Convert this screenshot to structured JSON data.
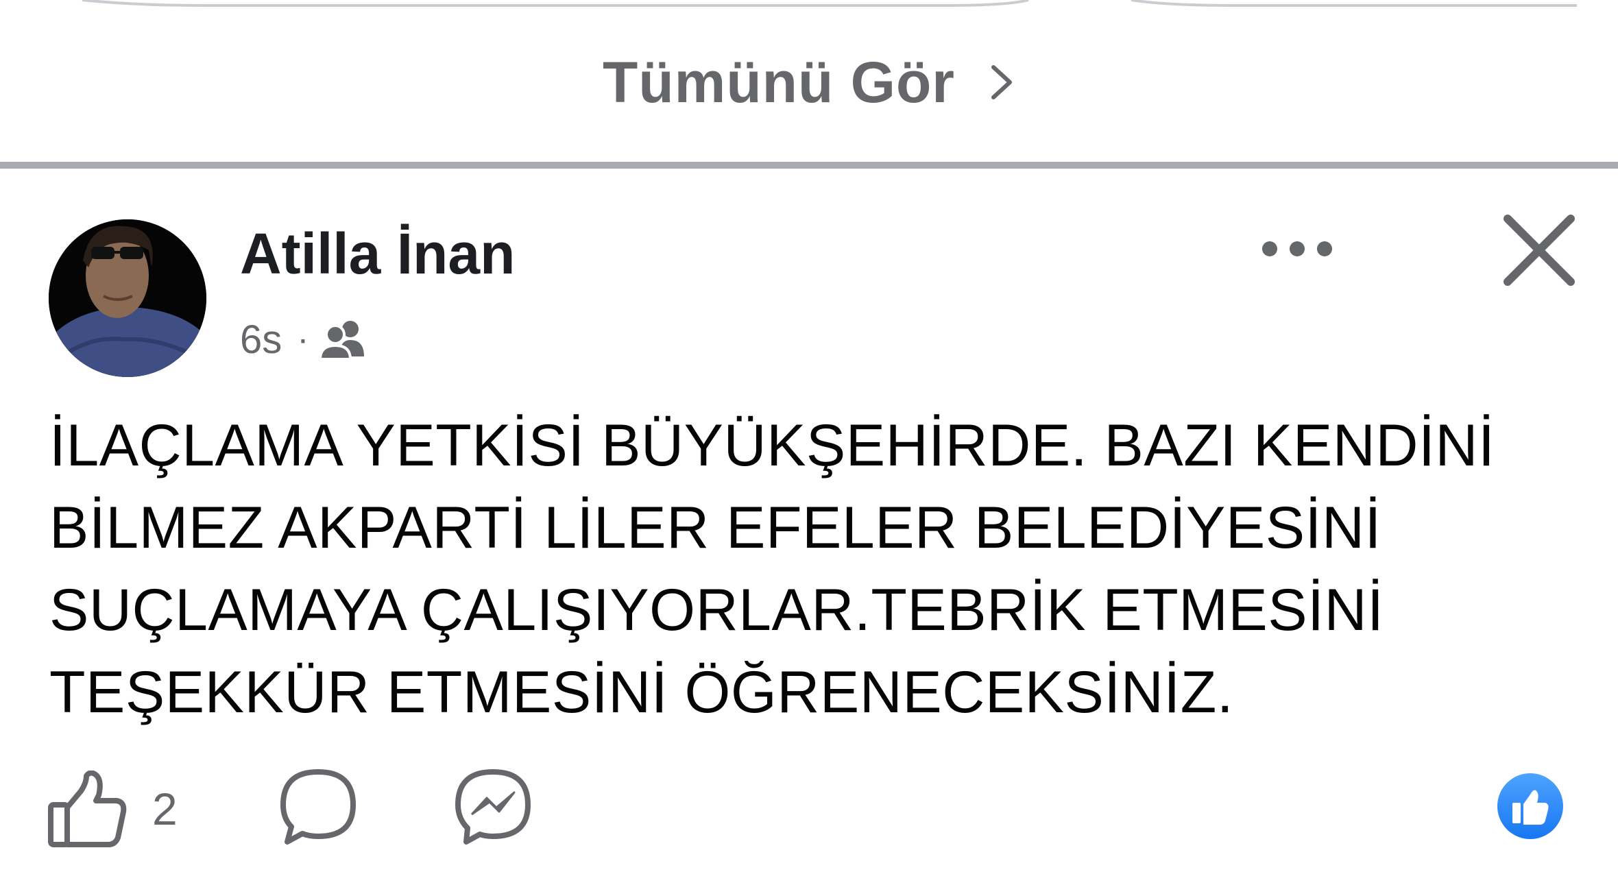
{
  "see_all": {
    "label": "Tümünü Gör",
    "chevron_icon": "chevron-right-icon"
  },
  "post": {
    "author": "Atilla İnan",
    "time": "6s",
    "separator": "·",
    "audience_icon": "friends-icon",
    "body": "İLAÇLAMA YETKİSİ BÜYÜKŞEHİRDE. BAZI KENDİNİ\nBİLMEZ AKPARTİ LİLER EFELER BELEDİYESİNİ\nSUÇLAMAYA ÇALIŞIYORLAR.TEBRİK ETMESİNİ\nTEŞEKKÜR ETMESİNİ ÖĞRENECEKSİNİZ.",
    "actions": {
      "like_icon": "thumbs-up-icon",
      "like_count": "2",
      "comment_icon": "comment-icon",
      "share_icon": "messenger-icon"
    },
    "reaction_icon": "like-reaction-icon"
  },
  "colors": {
    "secondary_text": "#65676b",
    "divider": "#a8abaf",
    "accent": "#1877f2"
  }
}
